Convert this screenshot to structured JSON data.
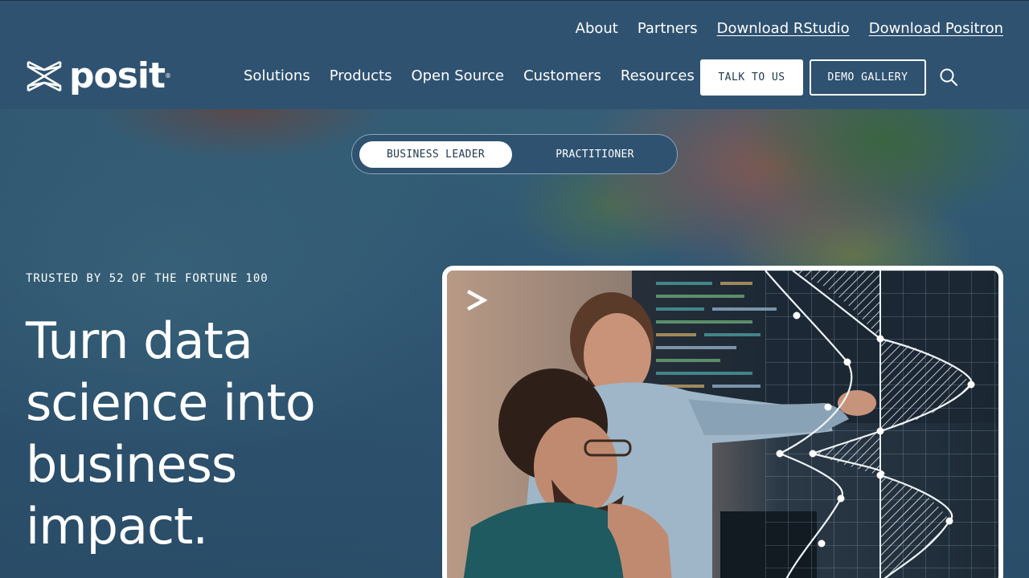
{
  "utility_nav": {
    "about": "About",
    "partners": "Partners",
    "download_rstudio": "Download RStudio",
    "download_positron": "Download Positron"
  },
  "brand": {
    "name": "posit",
    "trademark": "®"
  },
  "main_nav": {
    "items": [
      "Solutions",
      "Products",
      "Open Source",
      "Customers",
      "Resources"
    ]
  },
  "header_actions": {
    "talk_label": "TALK TO US",
    "demo_label": "DEMO GALLERY",
    "search_icon": "search-icon"
  },
  "audience_toggle": {
    "options": [
      "BUSINESS LEADER",
      "PRACTITIONER"
    ],
    "selected": "BUSINESS LEADER"
  },
  "hero": {
    "eyebrow": "TRUSTED BY 52 OF THE FORTUNE 100",
    "headline_lines": [
      "Turn data",
      "science into",
      "business",
      "impact."
    ]
  },
  "colors": {
    "header_bg": "#2f5271",
    "button_text": "#213a52",
    "white": "#ffffff"
  }
}
